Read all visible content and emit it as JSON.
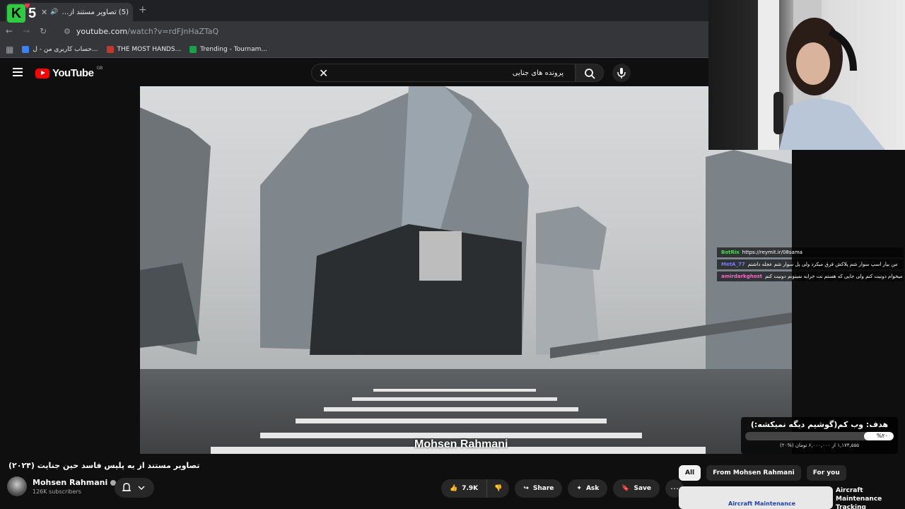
{
  "tab": {
    "title": "(5) تصاویر مستند از یه پلیس",
    "new_tab": "+",
    "close": "✕"
  },
  "stream_logo": {
    "letter": "K",
    "number": "5"
  },
  "address": {
    "url_host": "youtube.com",
    "url_path": "/watch?v=rdFJnHaZTaQ"
  },
  "bookmarks": [
    {
      "label": "حساب کاربری من - ل...",
      "color": "#3b82f6"
    },
    {
      "label": "THE MOST HANDS...",
      "color": "#c0392b"
    },
    {
      "label": "Trending - Tournam...",
      "color": "#16a34a"
    }
  ],
  "youtube": {
    "logo_text": "YouTube",
    "region": "GB",
    "search_query": "پرونده های جنایی"
  },
  "video": {
    "watermark": "Mohsen Rahmani"
  },
  "chat": [
    {
      "name": "BotRix",
      "name_color": "#44dd44",
      "text": "https://reymit.ir/08sama"
    },
    {
      "name": "MetA_77",
      "name_color": "#7a7aff",
      "text": "من بیار اسپ سوار شم پلاکش فرق میکرد ولی پل سوار شم عجله داشتم"
    },
    {
      "name": "amirdarkghost",
      "name_color": "#ff66cc",
      "text": "من میخوام دونیت کنم ولی جایی که هستم نت خرابه نمیتونم دونیت کنم"
    }
  ],
  "goal": {
    "title": "هدف: وب کم(گوشیم دیگه نمیکشه:)",
    "percent_label": "%۲۰",
    "percent": 20,
    "amount": "۱,۱۷۴,۵۵۵ از ۶,۰۰۰,۰۰۰ تومان (%۲۰)"
  },
  "video_title": "تصاویر مستند از یه پلیس فاسد حین جنایت (۲۰۲۴)",
  "channel": {
    "name": "Mohsen Rahmani",
    "subscribers": "126K subscribers"
  },
  "actions": {
    "likes": "7.9K",
    "share": "Share",
    "ask": "Ask",
    "save": "Save"
  },
  "chips": [
    "All",
    "From Mohsen Rahmani",
    "For you"
  ],
  "recommended": {
    "title": "Aircraft Maintenance Tracking",
    "thumb_text": "Aircraft Maintenance"
  }
}
